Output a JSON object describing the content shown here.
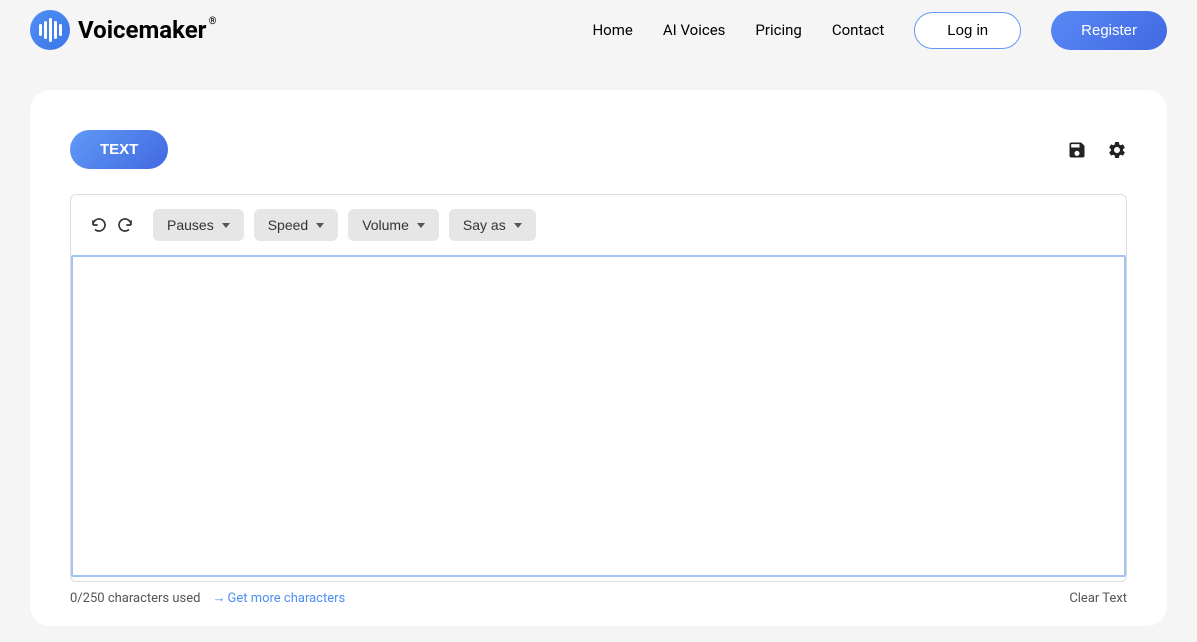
{
  "brand": {
    "name": "Voicemaker"
  },
  "nav": {
    "home": "Home",
    "voices": "AI Voices",
    "pricing": "Pricing",
    "contact": "Contact",
    "login": "Log in",
    "register": "Register"
  },
  "editor": {
    "tab": "TEXT",
    "toolbar": {
      "pauses": "Pauses",
      "speed": "Speed",
      "volume": "Volume",
      "sayas": "Say as"
    },
    "textValue": ""
  },
  "footer": {
    "charCount": "0/250 characters used",
    "getMore": "Get more characters",
    "clear": "Clear Text"
  }
}
